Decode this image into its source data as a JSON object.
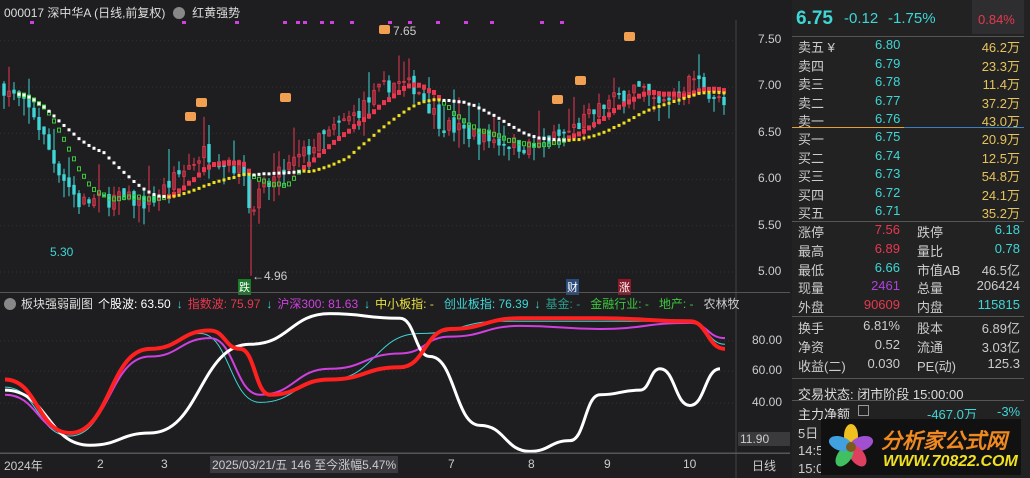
{
  "header": {
    "code": "000017",
    "name": "深中华A",
    "period": "(日线,前复权)",
    "indicator": "红黄强势"
  },
  "main_chart": {
    "price_ticks": [
      "7.50",
      "7.00",
      "6.50",
      "6.00",
      "5.50",
      "5.00"
    ],
    "high_label": "7.65",
    "low_label": "←4.96",
    "left_low_label": "5.30",
    "markers": {
      "fall": "跌",
      "finance": "财",
      "rise": "涨"
    },
    "price_anchors": [
      [
        0,
        7.0
      ],
      [
        12,
        6.7
      ],
      [
        20,
        6.2
      ],
      [
        30,
        5.75
      ],
      [
        45,
        5.8
      ],
      [
        58,
        5.75
      ],
      [
        68,
        6.0
      ],
      [
        80,
        6.3
      ],
      [
        96,
        6.1
      ],
      [
        98,
        5.7
      ],
      [
        108,
        6.0
      ],
      [
        125,
        6.4
      ],
      [
        140,
        6.7
      ],
      [
        150,
        6.95
      ],
      [
        155,
        7.05
      ],
      [
        165,
        7.0
      ],
      [
        175,
        6.6
      ],
      [
        192,
        6.45
      ],
      [
        210,
        6.35
      ],
      [
        225,
        6.5
      ],
      [
        240,
        6.8
      ],
      [
        252,
        7.0
      ],
      [
        262,
        6.8
      ],
      [
        276,
        7.1
      ],
      [
        290,
        6.75
      ]
    ]
  },
  "sub_chart": {
    "title": "板块强弱副图",
    "legend": [
      {
        "label": "个股波: 63.50",
        "arrow": "↓",
        "color": "#ffffff"
      },
      {
        "label": "指数波: 75.97",
        "arrow": "↓",
        "color": "#e8384f"
      },
      {
        "label": "沪深300: 81.63",
        "arrow": "↓",
        "color": "#d040e0"
      },
      {
        "label": "中小板指: -",
        "arrow": "",
        "color": "#e8e03c"
      },
      {
        "label": "创业板指: 76.39",
        "arrow": "↓",
        "color": "#3ed6d6"
      },
      {
        "label": "基金: -",
        "arrow": "",
        "color": "#2a9a8a"
      },
      {
        "label": "金融行业: -",
        "arrow": "",
        "color": "#3cc83c"
      },
      {
        "label": "地产: -",
        "arrow": "",
        "color": "#3cc83c"
      },
      {
        "label": "农林牧渔:",
        "arrow": "",
        "color": "#cccccc"
      }
    ],
    "ticks": [
      "80.00",
      "60.00",
      "40.00"
    ],
    "cursor_value": "11.90",
    "series": {
      "red": [
        [
          5,
          55
        ],
        [
          70,
          20
        ],
        [
          150,
          75
        ],
        [
          210,
          87
        ],
        [
          240,
          75
        ],
        [
          270,
          45
        ],
        [
          330,
          55
        ],
        [
          400,
          63
        ],
        [
          450,
          88
        ],
        [
          520,
          95
        ],
        [
          600,
          95
        ],
        [
          690,
          93
        ],
        [
          725,
          75
        ]
      ],
      "magenta": [
        [
          5,
          45
        ],
        [
          70,
          20
        ],
        [
          150,
          70
        ],
        [
          210,
          82
        ],
        [
          260,
          45
        ],
        [
          330,
          62
        ],
        [
          400,
          72
        ],
        [
          450,
          83
        ],
        [
          520,
          90
        ],
        [
          600,
          88
        ],
        [
          690,
          92
        ],
        [
          725,
          82
        ]
      ],
      "cyan": [
        [
          5,
          50
        ],
        [
          70,
          18
        ],
        [
          150,
          75
        ],
        [
          200,
          85
        ],
        [
          260,
          40
        ],
        [
          330,
          55
        ],
        [
          420,
          85
        ],
        [
          500,
          93
        ],
        [
          600,
          93
        ],
        [
          690,
          93
        ],
        [
          725,
          78
        ]
      ],
      "white": [
        [
          5,
          48
        ],
        [
          90,
          12
        ],
        [
          150,
          20
        ],
        [
          250,
          78
        ],
        [
          330,
          98
        ],
        [
          400,
          95
        ],
        [
          430,
          70
        ],
        [
          480,
          25
        ],
        [
          530,
          8
        ],
        [
          570,
          15
        ],
        [
          600,
          45
        ],
        [
          640,
          48
        ],
        [
          660,
          62
        ],
        [
          690,
          38
        ],
        [
          720,
          62
        ]
      ]
    }
  },
  "time_axis": {
    "labels": [
      "2024年",
      "2",
      "3",
      "7",
      "8",
      "9",
      "10"
    ],
    "cursor": "2025/03/21/五 146 至今涨幅5.47%",
    "period": "日线"
  },
  "quote": {
    "price": "6.75",
    "change": "-0.12",
    "pct": "-1.75%",
    "ratio": "0.84%",
    "asks": [
      [
        "卖五 ¥",
        "6.80",
        "46.2万"
      ],
      [
        "卖四",
        "6.79",
        "23.3万"
      ],
      [
        "卖三",
        "6.78",
        "11.4万"
      ],
      [
        "卖二",
        "6.77",
        "37.2万"
      ],
      [
        "卖一",
        "6.76",
        "43.0万"
      ]
    ],
    "bids": [
      [
        "买一",
        "6.75",
        "20.9万"
      ],
      [
        "买二",
        "6.74",
        "12.5万"
      ],
      [
        "买三",
        "6.73",
        "54.8万"
      ],
      [
        "买四",
        "6.72",
        "24.1万"
      ],
      [
        "买五",
        "6.71",
        "35.2万"
      ]
    ],
    "stats1": [
      [
        "涨停",
        "7.56",
        "跌停",
        "6.18"
      ],
      [
        "最高",
        "6.89",
        "量比",
        "0.78"
      ],
      [
        "最低",
        "6.66",
        "市值AB",
        "46.5亿"
      ],
      [
        "现量",
        "2461",
        "总量",
        "206424"
      ],
      [
        "外盘",
        "90609",
        "内盘",
        "115815"
      ]
    ],
    "stats2": [
      [
        "换手",
        "6.81%",
        "股本",
        "6.89亿"
      ],
      [
        "净资",
        "0.52",
        "流通",
        "3.03亿"
      ],
      [
        "收益(二)",
        "0.030",
        "PE(动)",
        "125.3"
      ]
    ],
    "status": "交易状态: 闭市阶段 15:00:00",
    "main_flow_label": "主力净额",
    "main_flow_value": "-467.0万",
    "main_flow_pct": "-3%",
    "partial_rows": [
      "5日",
      "14:5",
      "15:0"
    ]
  },
  "watermark": {
    "title": "分析家公式网",
    "url": "WWW.70822.COM"
  }
}
